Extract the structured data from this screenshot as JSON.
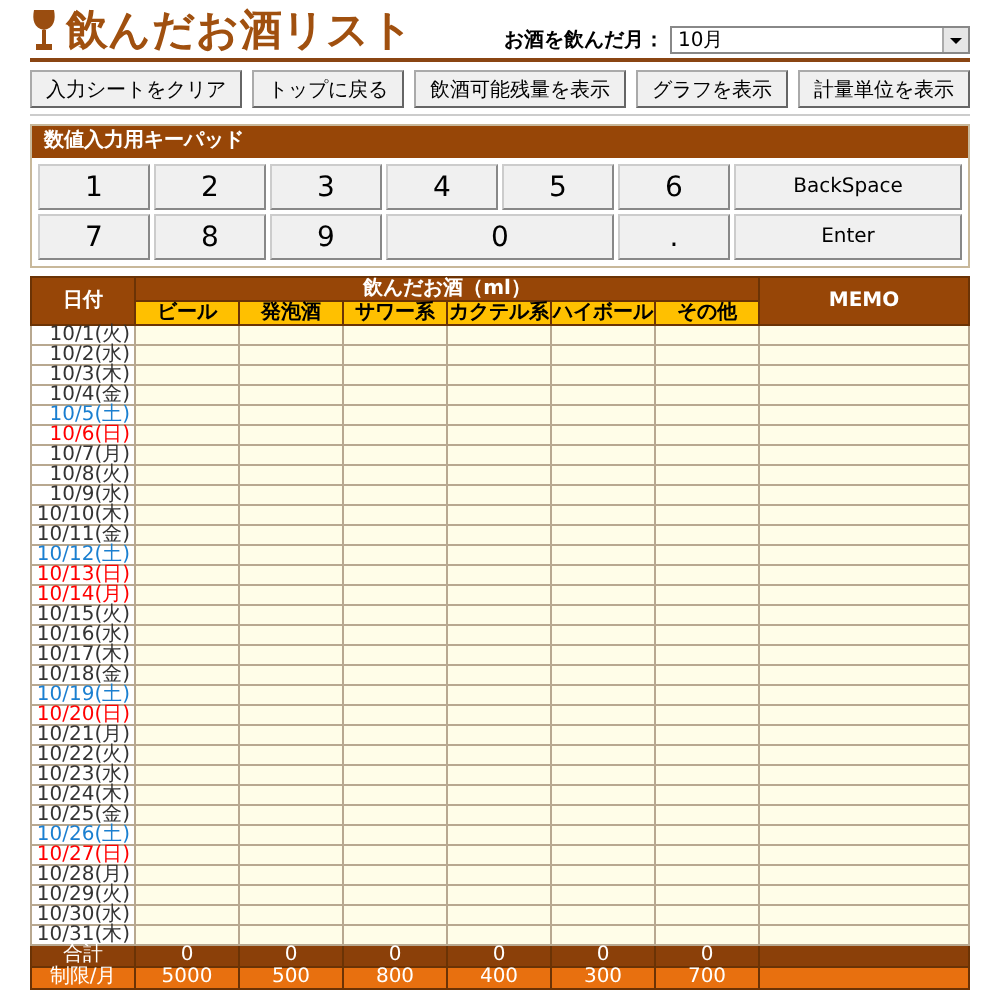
{
  "header": {
    "title": "飲んだお酒リスト",
    "month_label": "お酒を飲んだ月：",
    "month_value": "10月"
  },
  "toolbar": [
    "入力シートをクリア",
    "トップに戻る",
    "飲酒可能残量を表示",
    "グラフを表示",
    "計量単位を表示"
  ],
  "keypad": {
    "title": "数値入力用キーパッド",
    "keys": [
      {
        "label": "1",
        "kind": "digit"
      },
      {
        "label": "2",
        "kind": "digit"
      },
      {
        "label": "3",
        "kind": "digit"
      },
      {
        "label": "4",
        "kind": "digit"
      },
      {
        "label": "5",
        "kind": "digit"
      },
      {
        "label": "6",
        "kind": "digit"
      },
      {
        "label": "BackSpace",
        "kind": "command"
      },
      {
        "label": "7",
        "kind": "digit"
      },
      {
        "label": "8",
        "kind": "digit"
      },
      {
        "label": "9",
        "kind": "digit"
      },
      {
        "label": "0",
        "kind": "wide"
      },
      {
        "label": ".",
        "kind": "digit"
      },
      {
        "label": "Enter",
        "kind": "command"
      }
    ]
  },
  "table": {
    "date_header": "日付",
    "group_header": "飲んだお酒（ml）",
    "memo_header": "MEMO",
    "columns": [
      "ビール",
      "発泡酒",
      "サワー系",
      "カクテル系",
      "ハイボール",
      "その他"
    ],
    "rows": [
      {
        "date": "10/1(火)",
        "kind": "weekday"
      },
      {
        "date": "10/2(水)",
        "kind": "weekday"
      },
      {
        "date": "10/3(木)",
        "kind": "weekday"
      },
      {
        "date": "10/4(金)",
        "kind": "weekday"
      },
      {
        "date": "10/5(土)",
        "kind": "saturday"
      },
      {
        "date": "10/6(日)",
        "kind": "holiday"
      },
      {
        "date": "10/7(月)",
        "kind": "weekday"
      },
      {
        "date": "10/8(火)",
        "kind": "weekday"
      },
      {
        "date": "10/9(水)",
        "kind": "weekday"
      },
      {
        "date": "10/10(木)",
        "kind": "weekday"
      },
      {
        "date": "10/11(金)",
        "kind": "weekday"
      },
      {
        "date": "10/12(土)",
        "kind": "saturday"
      },
      {
        "date": "10/13(日)",
        "kind": "holiday"
      },
      {
        "date": "10/14(月)",
        "kind": "holiday"
      },
      {
        "date": "10/15(火)",
        "kind": "weekday"
      },
      {
        "date": "10/16(水)",
        "kind": "weekday"
      },
      {
        "date": "10/17(木)",
        "kind": "weekday"
      },
      {
        "date": "10/18(金)",
        "kind": "weekday"
      },
      {
        "date": "10/19(土)",
        "kind": "saturday"
      },
      {
        "date": "10/20(日)",
        "kind": "holiday"
      },
      {
        "date": "10/21(月)",
        "kind": "weekday"
      },
      {
        "date": "10/22(火)",
        "kind": "weekday"
      },
      {
        "date": "10/23(水)",
        "kind": "weekday"
      },
      {
        "date": "10/24(木)",
        "kind": "weekday"
      },
      {
        "date": "10/25(金)",
        "kind": "weekday"
      },
      {
        "date": "10/26(土)",
        "kind": "saturday"
      },
      {
        "date": "10/27(日)",
        "kind": "holiday"
      },
      {
        "date": "10/28(月)",
        "kind": "weekday"
      },
      {
        "date": "10/29(火)",
        "kind": "weekday"
      },
      {
        "date": "10/30(水)",
        "kind": "weekday"
      },
      {
        "date": "10/31(木)",
        "kind": "weekday"
      }
    ],
    "totals": {
      "label": "合計",
      "values": [
        "0",
        "0",
        "0",
        "0",
        "0",
        "0"
      ]
    },
    "limits": {
      "label": "制限/月",
      "values": [
        "5000",
        "500",
        "800",
        "400",
        "300",
        "700"
      ]
    }
  }
}
